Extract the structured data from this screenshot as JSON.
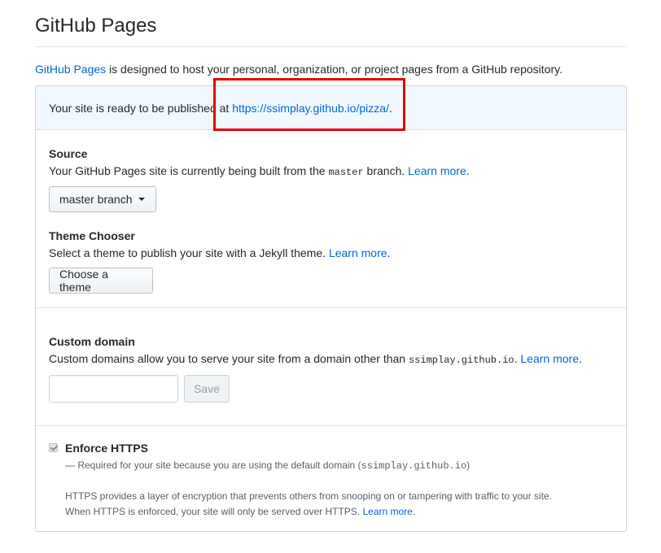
{
  "page_title": "GitHub Pages",
  "intro": {
    "link": "GitHub Pages",
    "text": " is designed to host your personal, organization, or project pages from a GitHub repository."
  },
  "flash": {
    "prefix": "Your site is ready to be published at ",
    "url": "https://ssimplay.github.io/pizza/",
    "suffix": "."
  },
  "source": {
    "heading": "Source",
    "desc_prefix": "Your GitHub Pages site is currently being built from the ",
    "branch_code": "master",
    "desc_suffix": " branch. ",
    "learn_more": "Learn more",
    "period": ".",
    "button": "master branch"
  },
  "theme": {
    "heading": "Theme Chooser",
    "desc": "Select a theme to publish your site with a Jekyll theme. ",
    "learn_more": "Learn more",
    "period": ".",
    "button": "Choose a theme"
  },
  "custom_domain": {
    "heading": "Custom domain",
    "desc_prefix": "Custom domains allow you to serve your site from a domain other than ",
    "domain_code": "ssimplay.github.io",
    "desc_suffix": ". ",
    "learn_more": "Learn more",
    "period": ".",
    "input_value": "",
    "save": "Save"
  },
  "https": {
    "checked": true,
    "label": "Enforce HTTPS",
    "note_prefix": "— Required for your site because you are using the default domain (",
    "note_code": "ssimplay.github.io",
    "note_suffix": ")",
    "info_line1": "HTTPS provides a layer of encryption that prevents others from snooping on or tampering with traffic to your site.",
    "info_line2": "When HTTPS is enforced, your site will only be served over HTTPS. ",
    "learn_more": "Learn more",
    "period": "."
  },
  "colors": {
    "link": "#0366d6",
    "flash_bg": "#f1f8ff",
    "highlight_border": "#e60000"
  }
}
